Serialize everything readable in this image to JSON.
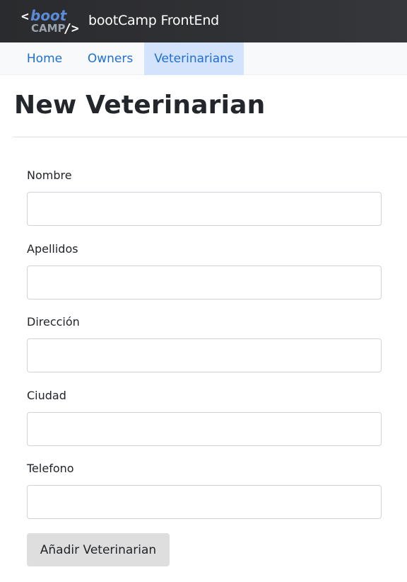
{
  "header": {
    "logo": {
      "icon": "bootcamp-logo",
      "top_text": "boot",
      "bottom_text": "CAMP",
      "colors": {
        "bracket": "#ffffff",
        "boot": "#5b8bd6",
        "camp": "#9aa3ad"
      }
    },
    "title": "bootCamp FrontEnd"
  },
  "nav": {
    "items": [
      {
        "label": "Home",
        "active": false
      },
      {
        "label": "Owners",
        "active": false
      },
      {
        "label": "Veterinarians",
        "active": true
      }
    ],
    "active_bg": "#d3e3fb",
    "link_color": "#1f6fcf"
  },
  "page": {
    "title": "New Veterinarian"
  },
  "form": {
    "fields": [
      {
        "label": "Nombre",
        "value": "",
        "placeholder": ""
      },
      {
        "label": "Apellidos",
        "value": "",
        "placeholder": ""
      },
      {
        "label": "Dirección",
        "value": "",
        "placeholder": ""
      },
      {
        "label": "Ciudad",
        "value": "",
        "placeholder": ""
      },
      {
        "label": "Telefono",
        "value": "",
        "placeholder": ""
      }
    ],
    "submit_label": "Añadir Veterinarian"
  }
}
